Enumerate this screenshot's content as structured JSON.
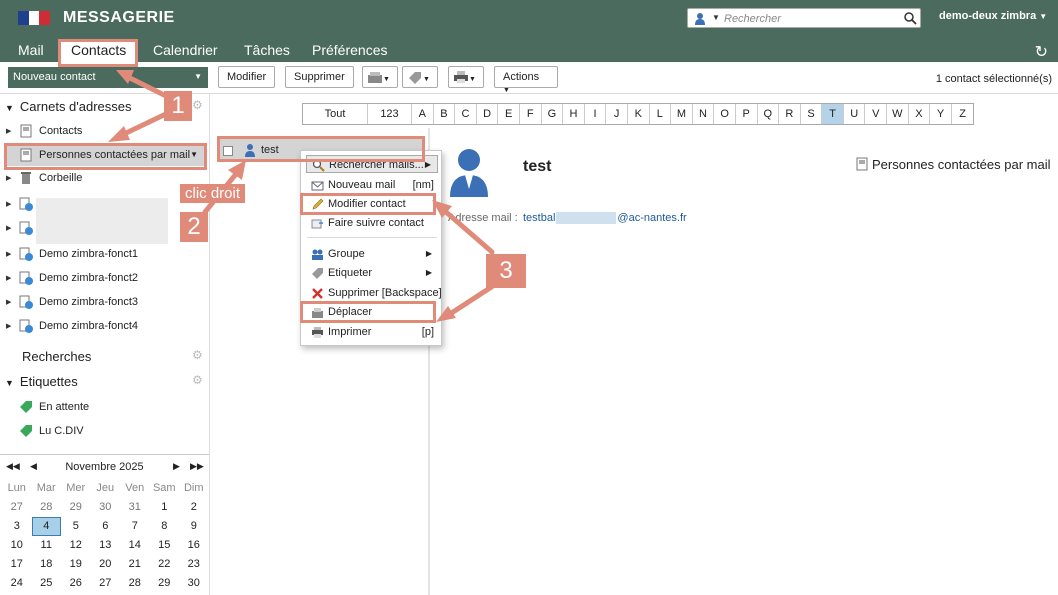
{
  "app": {
    "title": "MESSAGERIE",
    "user": "demo-deux zimbra",
    "search_placeholder": "Rechercher"
  },
  "tabs": [
    {
      "label": "Mail"
    },
    {
      "label": "Contacts"
    },
    {
      "label": "Calendrier"
    },
    {
      "label": "Tâches"
    },
    {
      "label": "Préférences"
    }
  ],
  "toolbar": {
    "new_contact": "Nouveau contact",
    "modify": "Modifier",
    "delete": "Supprimer",
    "actions": "Actions",
    "selection_status": "1 contact sélectionné(s)"
  },
  "sidebar": {
    "address_books_title": "Carnets d'adresses",
    "address_books": [
      {
        "label": "Contacts"
      },
      {
        "label": "Personnes contactées par mail"
      },
      {
        "label": "Corbeille"
      },
      {
        "label": ""
      },
      {
        "label": ""
      },
      {
        "label": "Demo zimbra-fonct1"
      },
      {
        "label": "Demo zimbra-fonct2"
      },
      {
        "label": "Demo zimbra-fonct3"
      },
      {
        "label": "Demo zimbra-fonct4"
      }
    ],
    "searches_title": "Recherches",
    "tags_title": "Etiquettes",
    "tags": [
      {
        "label": "En attente",
        "color": "#3aa85a"
      },
      {
        "label": "Lu C.DIV",
        "color": "#3aa85a"
      }
    ]
  },
  "calendar": {
    "month": "Novembre 2025",
    "weekdays": [
      "Lun",
      "Mar",
      "Mer",
      "Jeu",
      "Ven",
      "Sam",
      "Dim"
    ],
    "weeks": [
      [
        "27",
        "28",
        "29",
        "30",
        "31",
        "1",
        "2"
      ],
      [
        "3",
        "4",
        "5",
        "6",
        "7",
        "8",
        "9"
      ],
      [
        "10",
        "11",
        "12",
        "13",
        "14",
        "15",
        "16"
      ],
      [
        "17",
        "18",
        "19",
        "20",
        "21",
        "22",
        "23"
      ],
      [
        "24",
        "25",
        "26",
        "27",
        "28",
        "29",
        "30"
      ]
    ],
    "today": "4"
  },
  "alphabet": [
    "Tout",
    "123",
    "A",
    "B",
    "C",
    "D",
    "E",
    "F",
    "G",
    "H",
    "I",
    "J",
    "K",
    "L",
    "M",
    "N",
    "O",
    "P",
    "Q",
    "R",
    "S",
    "T",
    "U",
    "V",
    "W",
    "X",
    "Y",
    "Z"
  ],
  "alphabet_active": "T",
  "contact_list": [
    {
      "name": "test"
    }
  ],
  "detail": {
    "name": "test",
    "address_book": "Personnes contactées par mail",
    "email_label": "Adresse mail :",
    "email_prefix": "testbal",
    "email_suffix": "@ac-nantes.fr"
  },
  "context_menu": {
    "items": [
      {
        "label": "Rechercher mails...",
        "shortcut": "",
        "submenu": true
      },
      {
        "label": "Nouveau mail",
        "shortcut": "[nm]",
        "submenu": false
      },
      {
        "label": "Modifier contact",
        "shortcut": "",
        "submenu": false
      },
      {
        "label": "Faire suivre contact",
        "shortcut": "",
        "submenu": false
      },
      {
        "label": "Groupe",
        "shortcut": "",
        "submenu": true
      },
      {
        "label": "Etiqueter",
        "shortcut": "",
        "submenu": true
      },
      {
        "label": "Supprimer [Backspace]",
        "shortcut": "",
        "submenu": false
      },
      {
        "label": "Déplacer",
        "shortcut": "",
        "submenu": false
      },
      {
        "label": "Imprimer",
        "shortcut": "[p]",
        "submenu": false
      }
    ]
  },
  "annotations": {
    "step1": "1",
    "step2": "2",
    "step3": "3",
    "right_click_label": "clic droit",
    "color": "#e08b7a"
  }
}
